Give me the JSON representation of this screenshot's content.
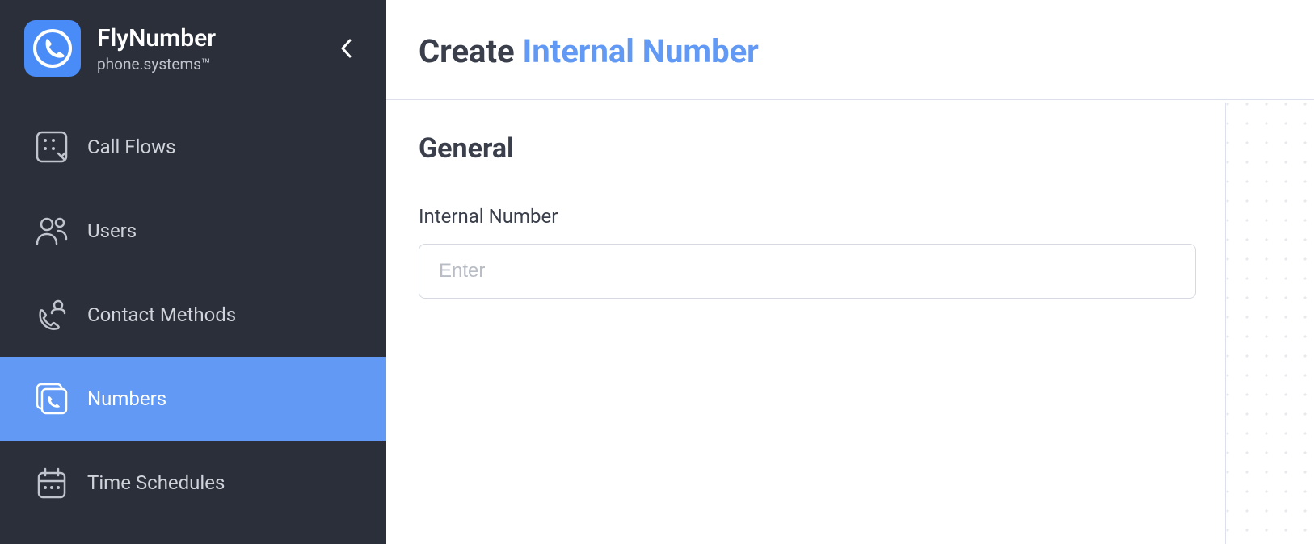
{
  "brand": {
    "title": "FlyNumber",
    "subtitle": "phone.systems™"
  },
  "sidebar": {
    "items": [
      {
        "label": "Call Flows",
        "icon": "call-flows",
        "active": false
      },
      {
        "label": "Users",
        "icon": "users",
        "active": false
      },
      {
        "label": "Contact Methods",
        "icon": "contact-methods",
        "active": false
      },
      {
        "label": "Numbers",
        "icon": "numbers",
        "active": true
      },
      {
        "label": "Time Schedules",
        "icon": "time-schedules",
        "active": false
      }
    ]
  },
  "header": {
    "title_prefix": "Create ",
    "title_accent": "Internal Number"
  },
  "form": {
    "section_title": "General",
    "internal_number": {
      "label": "Internal Number",
      "placeholder": "Enter",
      "value": ""
    }
  },
  "colors": {
    "accent": "#6199f5",
    "sidebar_bg": "#2a2f3a",
    "text_dark": "#3a3f4b"
  }
}
